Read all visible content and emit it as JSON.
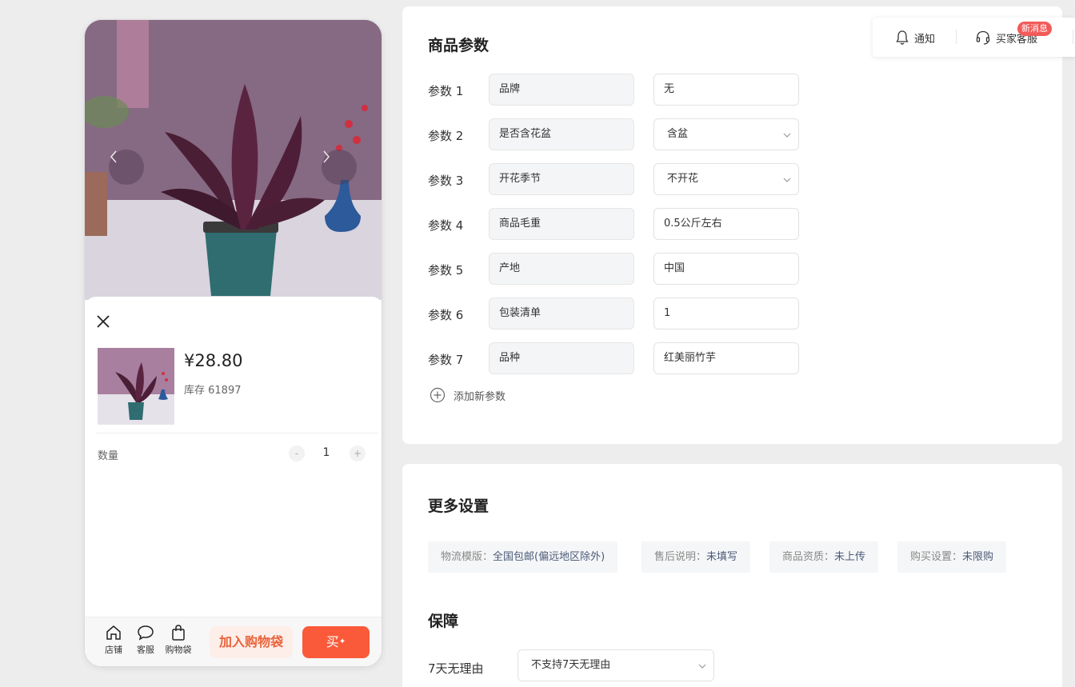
{
  "preview": {
    "carousel": {
      "prev_icon": "chevron-left-icon",
      "next_icon": "chevron-right-icon"
    },
    "sku_sheet": {
      "price": "¥28.80",
      "stock": "库存 61897",
      "quantity_label": "数量",
      "quantity_minus": "-",
      "quantity_value": "1",
      "quantity_plus": "+"
    },
    "bottom_bar": {
      "shop_label": "店铺",
      "service_label": "客服",
      "bag_label": "购物袋",
      "add_to_bag": "加入购物袋",
      "buy": "买"
    }
  },
  "params_card": {
    "title": "商品参数",
    "rows": [
      {
        "label": "参数 1",
        "key": "品牌",
        "value": "无",
        "type": "input"
      },
      {
        "label": "参数 2",
        "key": "是否含花盆",
        "value": "含盆",
        "type": "select"
      },
      {
        "label": "参数 3",
        "key": "开花季节",
        "value": "不开花",
        "type": "select"
      },
      {
        "label": "参数 4",
        "key": "商品毛重",
        "value": "0.5公斤左右",
        "type": "input"
      },
      {
        "label": "参数 5",
        "key": "产地",
        "value": "中国",
        "type": "input"
      },
      {
        "label": "参数 6",
        "key": "包装清单",
        "value": "1",
        "type": "input"
      },
      {
        "label": "参数 7",
        "key": "品种",
        "value": "红美丽竹芋",
        "type": "input"
      }
    ],
    "add_param": "添加新参数"
  },
  "more_card": {
    "title": "更多设置",
    "chips": [
      {
        "key": "物流模版：",
        "value": "全国包邮(偏远地区除外)"
      },
      {
        "key": "售后说明：",
        "value": "未填写"
      },
      {
        "key": "商品资质：",
        "value": "未上传"
      },
      {
        "key": "购买设置：",
        "value": "未限购"
      }
    ],
    "guarantee_title": "保障",
    "guarantee_label": "7天无理由",
    "guarantee_value": "不支持7天无理由"
  },
  "toolbar": {
    "notify": "通知",
    "service": "买家客服",
    "badge": "新消息"
  },
  "colors": {
    "accent": "#fa5a3a",
    "accent_soft": "#fdeee9",
    "badge": "#f25a5a"
  }
}
